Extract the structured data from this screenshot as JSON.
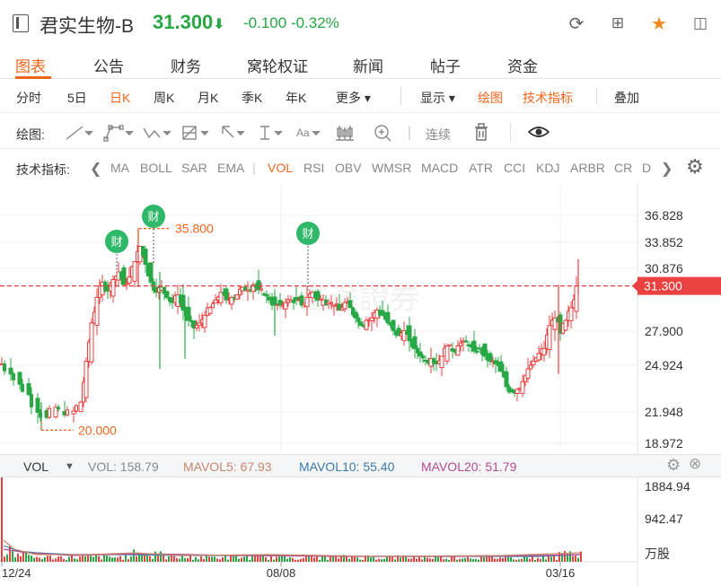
{
  "header": {
    "name": "君实生物-B",
    "price": "31.300",
    "arrow": "⬇",
    "change": "-0.100",
    "change_pct": "-0.32%",
    "icons": [
      "refresh-icon",
      "grid-icon",
      "star-icon",
      "sidebar-icon"
    ]
  },
  "tabs": [
    "图表",
    "公告",
    "财务",
    "窝轮权证",
    "新闻",
    "帖子",
    "资金"
  ],
  "periods": {
    "items": [
      "分时",
      "5日",
      "日K",
      "周K",
      "月K",
      "季K",
      "年K",
      "更多 ▾"
    ],
    "selected": "日K",
    "display": "显示 ▾",
    "draw": "绘图",
    "indicator": "技术指标",
    "overlay": "叠加"
  },
  "drawbar": {
    "label": "绘图:",
    "tools": [
      "line-tool-icon",
      "polyline-tool-icon",
      "wave-tool-icon",
      "fib-tool-icon",
      "arrow-tool-icon",
      "text-tool-icon",
      "font-tool-icon",
      "candle-tool-icon",
      "zoom-icon"
    ],
    "continuous": "连续",
    "icons": [
      "trash-icon",
      "eye-icon"
    ]
  },
  "indicators": {
    "label": "技术指标:",
    "items": [
      "MA",
      "BOLL",
      "SAR",
      "EMA",
      "|",
      "VOL",
      "RSI",
      "OBV",
      "WMSR",
      "MACD",
      "ATR",
      "CCI",
      "KDJ",
      "ARBR",
      "CR",
      "D"
    ],
    "selected": "VOL"
  },
  "chart_data": {
    "type": "candlestick",
    "y_ticks": [
      "36.828",
      "33.852",
      "30.876",
      "27.900",
      "24.924",
      "21.948",
      "18.972"
    ],
    "ylim": [
      18.972,
      38.0
    ],
    "current_price": "31.300",
    "high_label": "35.800",
    "low_label": "20.000",
    "markers": [
      "财",
      "财",
      "财"
    ],
    "x_labels": [
      "12/24",
      "08/08",
      "03/16"
    ],
    "watermark": "富途證券"
  },
  "volume": {
    "label": "VOL",
    "vol": "VOL: 158.79",
    "mavol5": "MAVOL5: 67.93",
    "mavol10": "MAVOL10: 55.40",
    "mavol20": "MAVOL20: 51.79",
    "y_ticks": [
      "1884.94",
      "942.47",
      "万股"
    ]
  },
  "colors": {
    "up": "#e94040",
    "down": "#27a844",
    "accent": "#f0651c",
    "price_line": "#e94040"
  }
}
